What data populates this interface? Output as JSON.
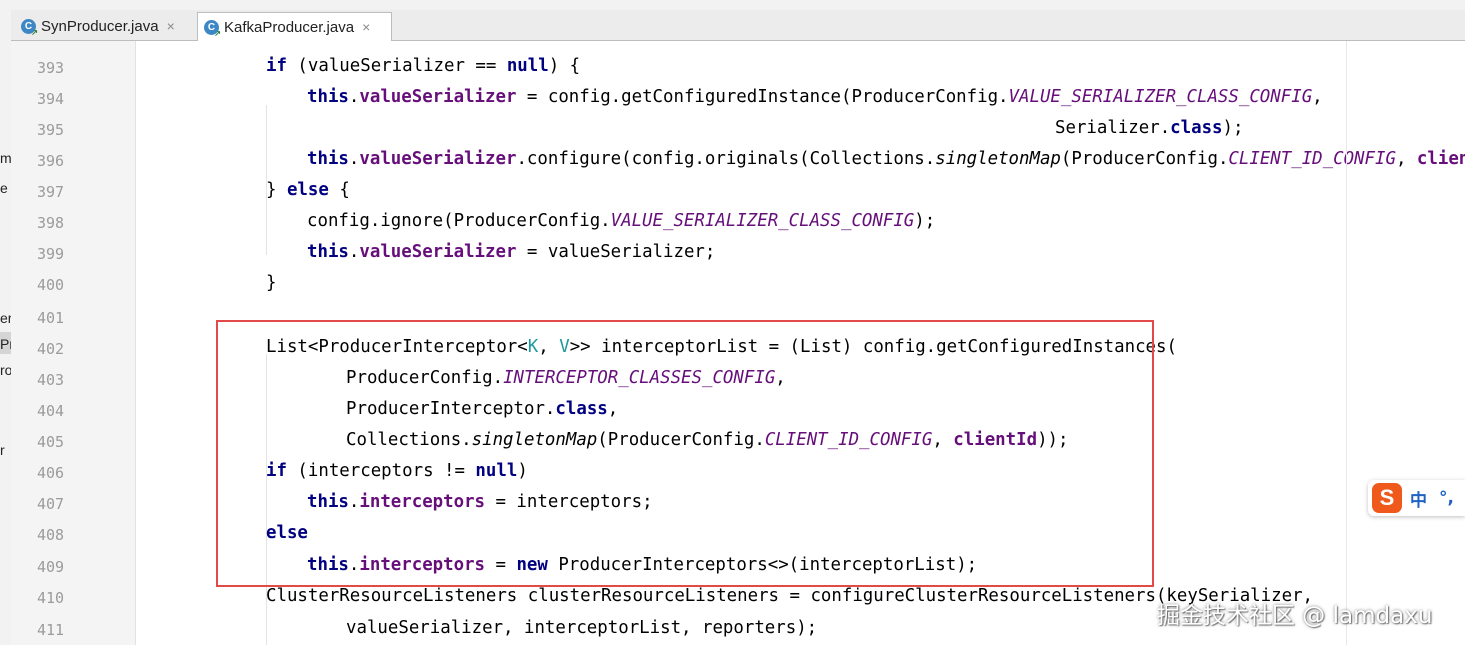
{
  "tabs": [
    {
      "label": "SynProducer.java",
      "icon": "java-class-icon",
      "active": false
    },
    {
      "label": "KafkaProducer.java",
      "icon": "java-class-icon",
      "active": true
    }
  ],
  "tab_icon_letter": "C",
  "tab_close_glyph": "×",
  "left_panel_fragments": [
    "m",
    "e",
    "er",
    "Pr",
    "ro",
    "r"
  ],
  "line_numbers": [
    "393",
    "394",
    "395",
    "396",
    "397",
    "398",
    "399",
    "400",
    "401",
    "402",
    "403",
    "404",
    "405",
    "406",
    "407",
    "408",
    "409",
    "410",
    "411"
  ],
  "code_lines": [
    [
      {
        "t": "if",
        "c": "kw"
      },
      {
        "t": " (valueSerializer == "
      },
      {
        "t": "null",
        "c": "kw"
      },
      {
        "t": ") {"
      }
    ],
    [
      {
        "t": "this",
        "c": "kw"
      },
      {
        "t": "."
      },
      {
        "t": "valueSerializer",
        "c": "fld"
      },
      {
        "t": " = config.getConfiguredInstance(ProducerConfig."
      },
      {
        "t": "VALUE_SERIALIZER_CLASS_CONFIG",
        "c": "cst"
      },
      {
        "t": ","
      }
    ],
    [
      {
        "t": "Serializer."
      },
      {
        "t": "class",
        "c": "kw"
      },
      {
        "t": ");"
      }
    ],
    [
      {
        "t": "this",
        "c": "kw"
      },
      {
        "t": "."
      },
      {
        "t": "valueSerializer",
        "c": "fld"
      },
      {
        "t": ".configure(config.originals(Collections."
      },
      {
        "t": "singletonMap",
        "c": "sm"
      },
      {
        "t": "(ProducerConfig."
      },
      {
        "t": "CLIENT_ID_CONFIG",
        "c": "cst"
      },
      {
        "t": ", "
      },
      {
        "t": "clientI",
        "c": "fld"
      }
    ],
    [
      {
        "t": "} "
      },
      {
        "t": "else",
        "c": "kw"
      },
      {
        "t": " {"
      }
    ],
    [
      {
        "t": "config.ignore(ProducerConfig."
      },
      {
        "t": "VALUE_SERIALIZER_CLASS_CONFIG",
        "c": "cst"
      },
      {
        "t": ");"
      }
    ],
    [
      {
        "t": "this",
        "c": "kw"
      },
      {
        "t": "."
      },
      {
        "t": "valueSerializer",
        "c": "fld"
      },
      {
        "t": " = valueSerializer;"
      }
    ],
    [
      {
        "t": "}"
      }
    ],
    [],
    [
      {
        "t": "List<ProducerInterceptor<"
      },
      {
        "t": "K",
        "c": "tp"
      },
      {
        "t": ", "
      },
      {
        "t": "V",
        "c": "tp"
      },
      {
        "t": ">> interceptorList = (List) config.getConfiguredInstances("
      }
    ],
    [
      {
        "t": "ProducerConfig."
      },
      {
        "t": "INTERCEPTOR_CLASSES_CONFIG",
        "c": "cst"
      },
      {
        "t": ","
      }
    ],
    [
      {
        "t": "ProducerInterceptor."
      },
      {
        "t": "class",
        "c": "kw"
      },
      {
        "t": ","
      }
    ],
    [
      {
        "t": "Collections."
      },
      {
        "t": "singletonMap",
        "c": "sm"
      },
      {
        "t": "(ProducerConfig."
      },
      {
        "t": "CLIENT_ID_CONFIG",
        "c": "cst"
      },
      {
        "t": ", "
      },
      {
        "t": "clientId",
        "c": "fld"
      },
      {
        "t": "));"
      }
    ],
    [
      {
        "t": "if",
        "c": "kw"
      },
      {
        "t": " (interceptors != "
      },
      {
        "t": "null",
        "c": "kw"
      },
      {
        "t": ")"
      }
    ],
    [
      {
        "t": "this",
        "c": "kw"
      },
      {
        "t": "."
      },
      {
        "t": "interceptors",
        "c": "fld"
      },
      {
        "t": " = interceptors;"
      }
    ],
    [
      {
        "t": "else",
        "c": "kw"
      }
    ],
    [
      {
        "t": "this",
        "c": "kw"
      },
      {
        "t": "."
      },
      {
        "t": "interceptors",
        "c": "fld"
      },
      {
        "t": " = "
      },
      {
        "t": "new",
        "c": "kw"
      },
      {
        "t": " ProducerInterceptors<>(interceptorList);"
      }
    ],
    [
      {
        "t": "ClusterResourceListeners clusterResourceListeners = configureClusterResourceListeners(keySerializer,"
      }
    ],
    [
      {
        "t": "valueSerializer, interceptorList, reporters);"
      }
    ]
  ],
  "ime": {
    "logo": "S",
    "mode": "中",
    "punct": "°,"
  },
  "watermark": "掘金技术社区 @ lamdaxu",
  "colors": {
    "keyword": "#000080",
    "field": "#660e7a",
    "type_param": "#20999d",
    "highlight_box": "#e24a4a"
  }
}
